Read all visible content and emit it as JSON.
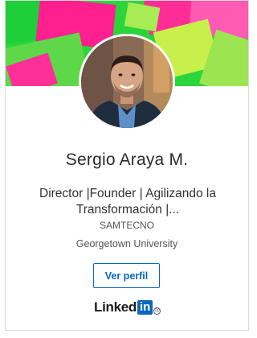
{
  "profile": {
    "name": "Sergio Araya M.",
    "headline_line1": "Director |Founder | Agilizando la",
    "headline_line2": "Transformación |...",
    "company": "SAMTECNO",
    "school": "Georgetown University"
  },
  "actions": {
    "view_profile_label": "Ver perfil"
  },
  "branding": {
    "logo_word": "Linked",
    "logo_in": "in",
    "logo_registered": "®",
    "accent_color": "#0a66c2"
  },
  "banner": {
    "colors": [
      "#2bd43a",
      "#ff1493",
      "#c6f24a",
      "#ff4fb0",
      "#7be24f"
    ]
  }
}
